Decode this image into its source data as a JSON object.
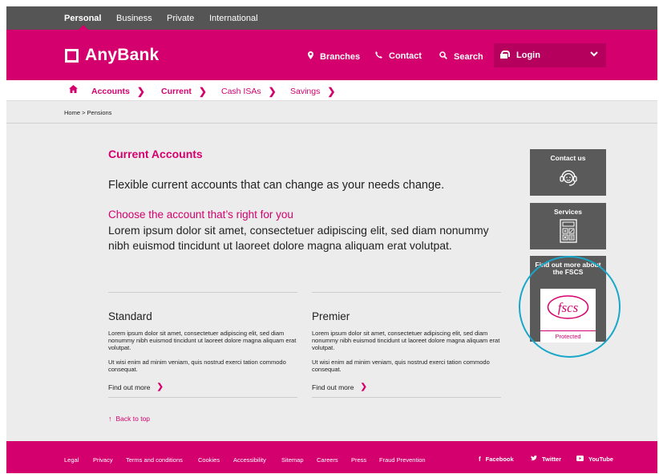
{
  "top_tabs": [
    "Personal",
    "Business",
    "Private",
    "International"
  ],
  "brand": {
    "name": "AnyBank",
    "accent": "#d4006e"
  },
  "header_nav": {
    "branches": "Branches",
    "contact": "Contact",
    "search": "Search",
    "login": "Login"
  },
  "subnav": [
    {
      "label": "Accounts"
    },
    {
      "label": "Current"
    },
    {
      "label": "Cash ISAs"
    },
    {
      "label": "Savings"
    }
  ],
  "breadcrumb": "Home > Pensions",
  "main": {
    "title": "Current Accounts",
    "lead": "Flexible current accounts that can change as your needs change.",
    "subheading": "Choose the account that’s right for you",
    "paragraph": "Lorem ipsum dolor sit amet, consectetuer adipiscing elit, sed diam nonummy nibh euismod tincidunt ut laoreet dolore magna aliquam erat volutpat."
  },
  "columns": [
    {
      "title": "Standard",
      "p1": "Lorem ipsum dolor sit amet, consectetuer adipiscing elit, sed diam nonummy nibh euismod tincidunt ut laoreet dolore magna aliquam erat volutpat.",
      "p2": "Ut wisi enim ad minim veniam, quis nostrud exerci tation commodo consequat.",
      "link": "Find out more"
    },
    {
      "title": "Premier",
      "p1": "Lorem ipsum dolor sit amet, consectetuer adipiscing elit, sed diam nonummy nibh euismod tincidunt ut laoreet dolore magna aliquam erat volutpat.",
      "p2": "Ut wisi enim ad minim veniam, quis nostrud exerci tation commodo consequat.",
      "link": "Find out more"
    }
  ],
  "back_to_top": "Back to top",
  "side_panels": {
    "contact": "Contact us",
    "services": "Services",
    "fscs": "Find out more about the FSCS",
    "fscs_logo": "fscs",
    "fscs_badge": "Protected"
  },
  "footer": {
    "links": [
      "Legal",
      "Privacy",
      "Terms and conditions",
      "Cookies",
      "Accessibility",
      "Sitemap",
      "Careers",
      "Press",
      "Fraud Prevention"
    ],
    "social": [
      "Facebook",
      "Twitter",
      "YouTube"
    ]
  },
  "icons": [
    "map-pin-icon",
    "phone-icon",
    "search-icon",
    "lock-icon",
    "chevron-down-icon",
    "home-icon",
    "headset-icon",
    "calculator-icon",
    "arrow-up-icon",
    "facebook-icon",
    "twitter-icon",
    "youtube-icon"
  ]
}
